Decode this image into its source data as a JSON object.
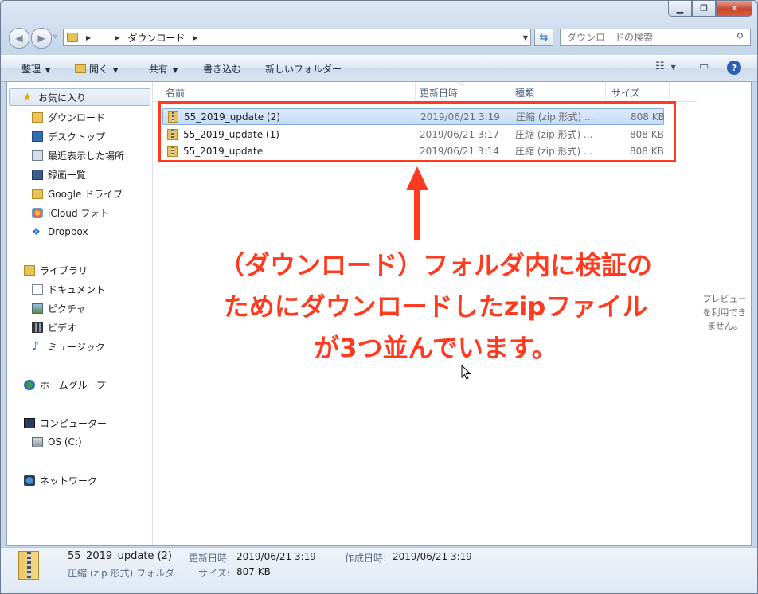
{
  "window": {
    "caption": {
      "min": "▁",
      "max": "❐",
      "close": "✕"
    }
  },
  "navbar": {
    "back_icon": "◀",
    "forward_icon": "▶",
    "history_icon": "▿",
    "breadcrumb": [
      "ダウンロード"
    ],
    "search_placeholder": "ダウンロードの検索"
  },
  "toolbar": {
    "organize": "整理",
    "open": "開く",
    "share": "共有",
    "burn": "書き込む",
    "new_folder": "新しいフォルダー",
    "view_icon": "☷",
    "pane_icon": "▭",
    "help_icon": "?"
  },
  "sidebar": {
    "favorites": {
      "label": "お気に入り",
      "items": [
        "ダウンロード",
        "デスクトップ",
        "最近表示した場所",
        "録画一覧",
        "Google ドライブ",
        "iCloud フォト",
        "Dropbox"
      ]
    },
    "libraries": {
      "label": "ライブラリ",
      "items": [
        "ドキュメント",
        "ピクチャ",
        "ビデオ",
        "ミュージック"
      ]
    },
    "homegroup": "ホームグループ",
    "computer": {
      "label": "コンピューター",
      "items": [
        "OS (C:)"
      ]
    },
    "network": "ネットワーク"
  },
  "columns": {
    "name": "名前",
    "date": "更新日時",
    "type": "種類",
    "size": "サイズ"
  },
  "files": [
    {
      "name": "55_2019_update (2)",
      "date": "2019/06/21 3:19",
      "type": "圧縮 (zip 形式) ...",
      "size": "808 KB",
      "selected": true
    },
    {
      "name": "55_2019_update (1)",
      "date": "2019/06/21 3:17",
      "type": "圧縮 (zip 形式) ...",
      "size": "808 KB",
      "selected": false
    },
    {
      "name": "55_2019_update",
      "date": "2019/06/21 3:14",
      "type": "圧縮 (zip 形式) ...",
      "size": "808 KB",
      "selected": false
    }
  ],
  "annotation": {
    "lines": [
      "（ダウンロード）フォルダ内に検証の",
      "ためにダウンロードしたzipファイル",
      "が3つ並んでいます。"
    ]
  },
  "preview": {
    "lines": [
      "プレビュー",
      "を利用でき",
      "ません。"
    ]
  },
  "status": {
    "name": "55_2019_update (2)",
    "type": "圧縮 (zip 形式) フォルダー",
    "modified_label": "更新日時:",
    "modified_value": "2019/06/21 3:19",
    "created_label": "作成日時:",
    "created_value": "2019/06/21 3:19",
    "size_label": "サイズ:",
    "size_value": "807 KB"
  },
  "colors": {
    "annotation": "#ff3b1f",
    "selection": "#c4dcf7"
  }
}
